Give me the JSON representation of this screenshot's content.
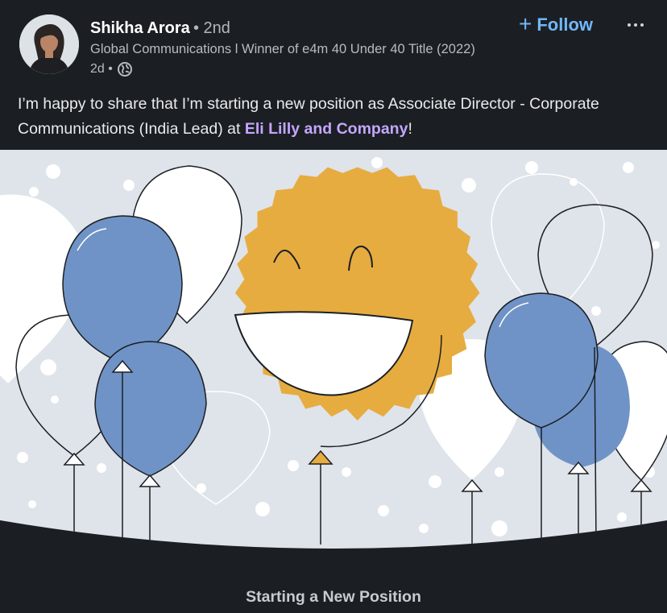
{
  "post": {
    "author": {
      "name": "Shikha Arora",
      "degree": "• 2nd",
      "headline": "Global Communications l Winner of e4m 40 Under 40 Title (2022)"
    },
    "timestamp": "2d •",
    "visibility_icon": "globe-icon",
    "follow_label": "Follow",
    "more_icon": "more-horizontal-icon",
    "text_before": "I’m happy to share that I’m starting a new position as Associate Director - Corporate Communications (India Lead) at ",
    "company": "Eli Lilly and Company",
    "text_after": "!",
    "image_caption": "Starting a New Position"
  },
  "colors": {
    "accent": "#71b7fb",
    "company_link": "#c4a6ff",
    "sun": "#e6ac3f",
    "balloon_blue": "#6f93c6",
    "background": "#1b1f23",
    "banner_bg": "#dfe3ea"
  }
}
